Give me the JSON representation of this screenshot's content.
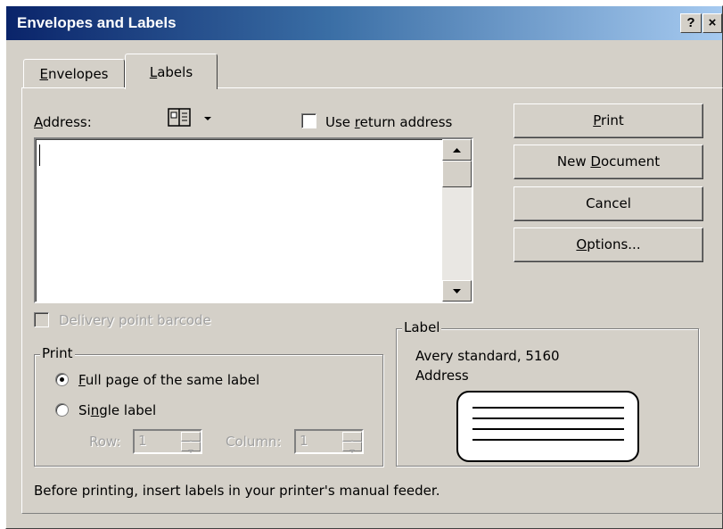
{
  "window": {
    "title": "Envelopes and Labels",
    "help_btn": "?",
    "close_btn": "×"
  },
  "tabs": [
    {
      "label": "Envelopes"
    },
    {
      "label": "Labels"
    }
  ],
  "address": {
    "label": "Address:",
    "value": ""
  },
  "use_return_address": {
    "label": "Use return address",
    "checked": false
  },
  "delivery_barcode": {
    "label": "Delivery point barcode",
    "enabled": false
  },
  "buttons": {
    "print": "Print",
    "new_document": "New Document",
    "cancel": "Cancel",
    "options": "Options..."
  },
  "print_group": {
    "legend": "Print",
    "full_page": "Full page of the same label",
    "single": "Single label",
    "selected": "full_page",
    "row_label": "Row:",
    "row_value": "1",
    "column_label": "Column:",
    "column_value": "1"
  },
  "label_group": {
    "legend": "Label",
    "name": "Avery standard, 5160",
    "type": "Address"
  },
  "footer": "Before printing, insert labels in your printer's manual feeder.",
  "colors": {
    "face": "#d4d0c8",
    "title_start": "#0a246a",
    "title_end": "#a6caf0"
  }
}
